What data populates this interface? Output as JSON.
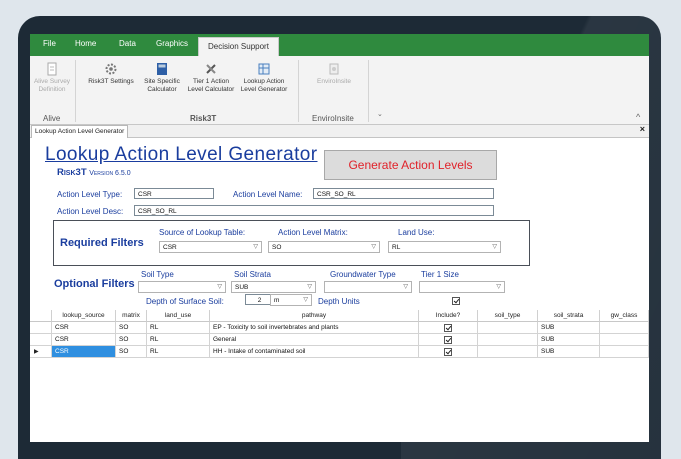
{
  "ribbon": {
    "tabs": [
      "File",
      "Home",
      "Data",
      "Graphics",
      "Decision Support"
    ],
    "active_tab": "Decision Support",
    "buttons": {
      "alive_survey": "Alive Survey\nDefinition",
      "risk3t_settings": "Risk3T Settings",
      "site_specific": "Site Specific\nCalculator",
      "tier1": "Tier 1 Action\nLevel Calculator",
      "lookup": "Lookup Action\nLevel Generator",
      "envirolnsite": "EnviroInsite"
    },
    "groups": {
      "alive": "Alive",
      "risk3t": "Risk3T",
      "envirolnsite": "EnviroInsite"
    }
  },
  "doc_tab": "Lookup Action Level Generator",
  "form": {
    "title": "Lookup Action Level Generator",
    "subtitle": "Risk3T",
    "version": "Version 6.5.0",
    "generate_label": "Generate Action Levels",
    "type_label": "Action Level Type:",
    "type_value": "CSR",
    "name_label": "Action Level Name:",
    "name_value": "CSR_SO_RL",
    "desc_label": "Action Level Desc:",
    "desc_value": "CSR_SO_RL",
    "required_label": "Required Filters",
    "source_label": "Source of Lookup Table:",
    "source_value": "CSR",
    "matrix_label": "Action Level Matrix:",
    "matrix_value": "SO",
    "landuse_label": "Land Use:",
    "landuse_value": "RL",
    "optional_label": "Optional Filters",
    "soil_type_label": "Soil Type",
    "soil_type_value": "",
    "soil_strata_label": "Soil Strata",
    "soil_strata_value": "SUB",
    "gw_type_label": "Groundwater Type",
    "gw_type_value": "",
    "tier1_label": "Tier 1 Size",
    "tier1_value": "",
    "depth_label": "Depth of Surface Soil:",
    "depth_value": "2",
    "depth_unit": "m",
    "depth_units_label": "Depth Units"
  },
  "grid": {
    "columns": [
      "lookup_source",
      "matrix",
      "land_use",
      "pathway",
      "Include?",
      "soil_type",
      "soil_strata",
      "gw_class"
    ],
    "rows": [
      {
        "lookup_source": "CSR",
        "matrix": "SO",
        "land_use": "RL",
        "pathway": "EP - Toxicity to soil invertebrates and plants",
        "include": true,
        "soil_type": "",
        "soil_strata": "SUB",
        "gw_class": ""
      },
      {
        "lookup_source": "CSR",
        "matrix": "SO",
        "land_use": "RL",
        "pathway": "General",
        "include": true,
        "soil_type": "",
        "soil_strata": "SUB",
        "gw_class": ""
      },
      {
        "lookup_source": "CSR",
        "matrix": "SO",
        "land_use": "RL",
        "pathway": "HH - Intake of contaminated soil",
        "include": true,
        "soil_type": "",
        "soil_strata": "SUB",
        "gw_class": ""
      }
    ]
  }
}
